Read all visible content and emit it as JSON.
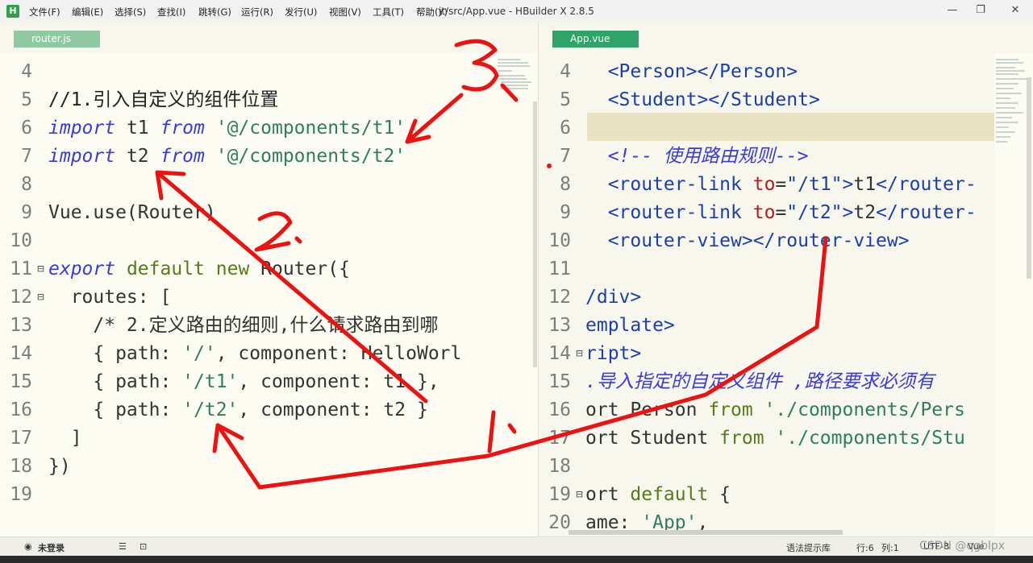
{
  "window": {
    "title": "jt/src/App.vue - HBuilder X 2.8.5",
    "logo": "H",
    "menu": [
      "文件(F)",
      "编辑(E)",
      "选择(S)",
      "查找(I)",
      "跳转(G)",
      "运行(R)",
      "发行(U)",
      "视图(V)",
      "工具(T)",
      "帮助(Y)"
    ],
    "controls": {
      "minimize": "—",
      "restore": "❐",
      "close": "✕"
    }
  },
  "tabs": {
    "left": "router.js",
    "right": "App.vue"
  },
  "left_editor": {
    "lines": [
      {
        "n": "4",
        "parts": []
      },
      {
        "n": "5",
        "parts": [
          [
            "cm",
            "//1.引入自定义的组件位置"
          ]
        ]
      },
      {
        "n": "6",
        "parts": [
          [
            "kw",
            "import"
          ],
          [
            "plain",
            " t1 "
          ],
          [
            "kw",
            "from"
          ],
          [
            "plain",
            " "
          ],
          [
            "str",
            "'@/components/t1'"
          ]
        ]
      },
      {
        "n": "7",
        "parts": [
          [
            "kw",
            "import"
          ],
          [
            "plain",
            " t2 "
          ],
          [
            "kw",
            "from"
          ],
          [
            "plain",
            " "
          ],
          [
            "str",
            "'@/components/t2'"
          ]
        ]
      },
      {
        "n": "8",
        "parts": []
      },
      {
        "n": "9",
        "parts": [
          [
            "plain",
            "Vue.use(Router)"
          ]
        ]
      },
      {
        "n": "10",
        "parts": []
      },
      {
        "n": "11",
        "fold": "⊟",
        "parts": [
          [
            "kw",
            "export"
          ],
          [
            "plain",
            " "
          ],
          [
            "kw2",
            "default"
          ],
          [
            "plain",
            " "
          ],
          [
            "kw2",
            "new"
          ],
          [
            "plain",
            " Router({"
          ]
        ]
      },
      {
        "n": "12",
        "fold": "⊟",
        "parts": [
          [
            "plain",
            "  routes: ["
          ]
        ]
      },
      {
        "n": "13",
        "parts": [
          [
            "plain",
            "    /* 2.定义路由的细则,什么请求路由到哪"
          ]
        ]
      },
      {
        "n": "14",
        "parts": [
          [
            "plain",
            "    { path: "
          ],
          [
            "str",
            "'/'"
          ],
          [
            "plain",
            ", component: HelloWorl"
          ]
        ]
      },
      {
        "n": "15",
        "parts": [
          [
            "plain",
            "    { path: "
          ],
          [
            "str",
            "'/t1'"
          ],
          [
            "plain",
            ", component: t1 },"
          ]
        ]
      },
      {
        "n": "16",
        "parts": [
          [
            "plain",
            "    { path: "
          ],
          [
            "str",
            "'/t2'"
          ],
          [
            "plain",
            ", component: t2 }"
          ]
        ]
      },
      {
        "n": "17",
        "parts": [
          [
            "plain",
            "  ]"
          ]
        ]
      },
      {
        "n": "18",
        "parts": [
          [
            "plain",
            "})"
          ]
        ]
      },
      {
        "n": "19",
        "parts": []
      }
    ]
  },
  "right_editor": {
    "lines": [
      {
        "n": "4",
        "parts": [
          [
            "tag",
            "  <Person></Person>"
          ]
        ]
      },
      {
        "n": "5",
        "parts": [
          [
            "tag",
            "  <Student></Student>"
          ]
        ]
      },
      {
        "n": "6",
        "parts": []
      },
      {
        "n": "7",
        "parts": [
          [
            "kw",
            "  <!-- 使用路由规则-->"
          ]
        ]
      },
      {
        "n": "8",
        "parts": [
          [
            "tag",
            "  <router-link "
          ],
          [
            "attr",
            "to"
          ],
          [
            "plain",
            "="
          ],
          [
            "tag",
            "\"/t1\""
          ],
          [
            "tag",
            ">"
          ],
          [
            "plain",
            "t1"
          ],
          [
            "tag",
            "</router-"
          ]
        ]
      },
      {
        "n": "9",
        "parts": [
          [
            "tag",
            "  <router-link "
          ],
          [
            "attr",
            "to"
          ],
          [
            "plain",
            "="
          ],
          [
            "tag",
            "\"/t2\""
          ],
          [
            "tag",
            ">"
          ],
          [
            "plain",
            "t2"
          ],
          [
            "tag",
            "</router-"
          ]
        ]
      },
      {
        "n": "10",
        "parts": [
          [
            "tag",
            "  <router-view></router-view>"
          ]
        ]
      },
      {
        "n": "11",
        "parts": []
      },
      {
        "n": "12",
        "parts": [
          [
            "tag",
            "/div>"
          ]
        ]
      },
      {
        "n": "13",
        "parts": [
          [
            "tag",
            "emplate>"
          ]
        ]
      },
      {
        "n": "14",
        "fold": "⊟",
        "parts": [
          [
            "tag",
            "ript>"
          ]
        ]
      },
      {
        "n": "15",
        "parts": [
          [
            "kw",
            ".导入指定的自定义组件 ,路径要求必须有"
          ]
        ]
      },
      {
        "n": "16",
        "parts": [
          [
            "plain",
            "ort Person "
          ],
          [
            "kw2",
            "from"
          ],
          [
            "plain",
            " "
          ],
          [
            "str",
            "'./components/Pers"
          ]
        ]
      },
      {
        "n": "17",
        "parts": [
          [
            "plain",
            "ort Student "
          ],
          [
            "kw2",
            "from"
          ],
          [
            "plain",
            " "
          ],
          [
            "str",
            "'./components/Stu"
          ]
        ]
      },
      {
        "n": "18",
        "parts": []
      },
      {
        "n": "19",
        "fold": "⊟",
        "parts": [
          [
            "plain",
            "ort "
          ],
          [
            "kw2",
            "default"
          ],
          [
            "plain",
            " {"
          ]
        ]
      },
      {
        "n": "20",
        "parts": [
          [
            "plain",
            "ame: "
          ],
          [
            "str",
            "'App'"
          ],
          [
            "plain",
            ","
          ]
        ]
      }
    ]
  },
  "annotations": {
    "marks": [
      "3.",
      "2.",
      "1."
    ],
    "color": "#ee1111"
  },
  "statusbar": {
    "login": "未登录",
    "syntax_hint": "语法提示库",
    "line": "行:6",
    "col": "列:1",
    "encoding": "UTF-8",
    "lang": "Vue",
    "watermark": "CSDN @qgblpx"
  }
}
